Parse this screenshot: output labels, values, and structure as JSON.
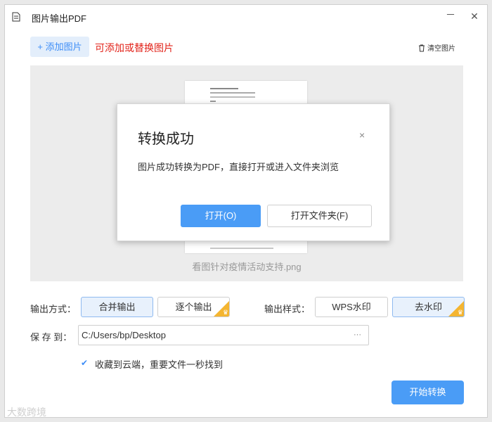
{
  "window": {
    "title": "图片输出PDF",
    "minimize": "－",
    "close": "✕"
  },
  "toolbar": {
    "add_label": "+ 添加图片",
    "hint": "可添加或替换图片",
    "clear_label": "清空图片"
  },
  "preview": {
    "file_name": "看图针对疫情活动支持.png"
  },
  "dialog": {
    "title": "转换成功",
    "close": "×",
    "message": "图片成功转换为PDF，直接打开或进入文件夹浏览",
    "open_label": "打开(O)",
    "folder_label": "打开文件夹(F)"
  },
  "output": {
    "mode_label": "输出方式：",
    "mode_options": [
      "合并输出",
      "逐个输出"
    ],
    "mode_selected": "合并输出",
    "style_label": "输出样式：",
    "style_options": [
      "WPS水印",
      "去水印"
    ],
    "style_selected": "去水印"
  },
  "save": {
    "label": "保 存 到：",
    "path": "C:/Users/bp/Desktop",
    "browse": "···"
  },
  "cloud": {
    "checked": true,
    "check_mark": "✔",
    "text": "收藏到云端，重要文件一秒找到"
  },
  "start_label": "开始转换",
  "watermark": "大数跨境",
  "colors": {
    "accent": "#4a9cf6",
    "hint_red": "#e2231a",
    "vip_gold": "#f4b531"
  }
}
